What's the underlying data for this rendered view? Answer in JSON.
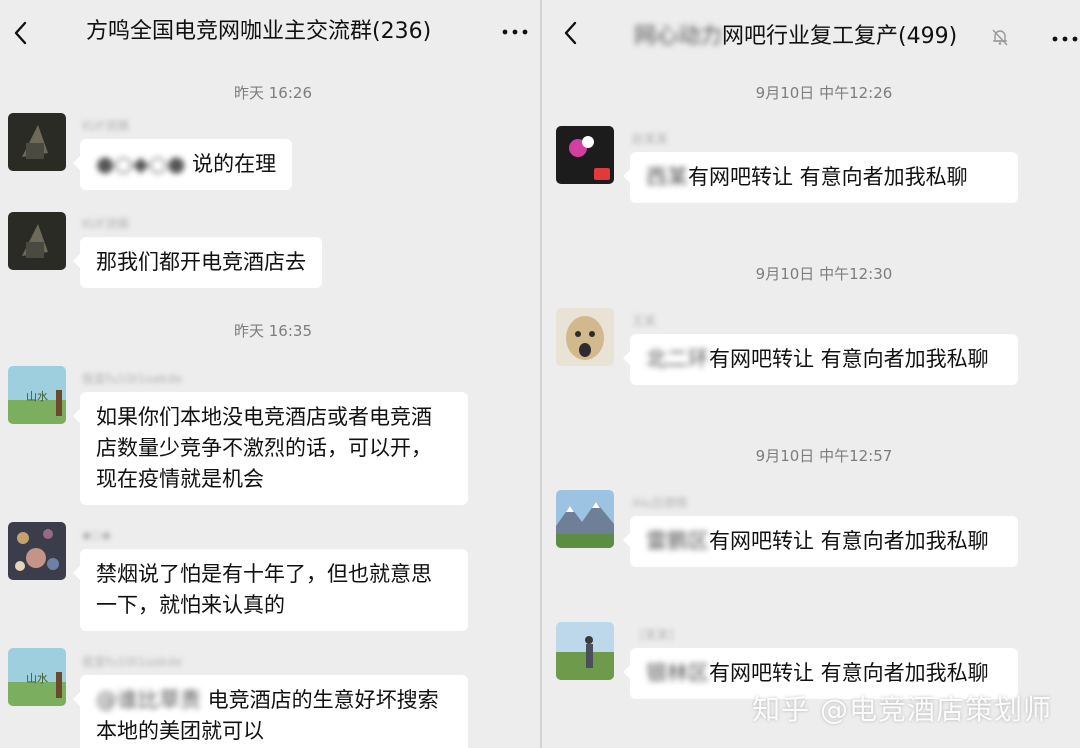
{
  "left_chat": {
    "title": "方鸣全国电竞网咖业主交流群(236)",
    "messages": [
      {
        "time": "昨天 16:26"
      },
      {
        "nick": "KUF测赛",
        "mention": "●○◆○● ",
        "text": "说的在理"
      },
      {
        "nick": "KUF测赛",
        "text": "那我们都开电竞酒店去"
      },
      {
        "time": "昨天 16:35"
      },
      {
        "nick": "我爱fu10t1oakde",
        "text": "如果你们本地没电竞酒店或者电竞酒店数量少竞争不激烈的话，可以开，现在疫情就是机会"
      },
      {
        "nick": "◆○◆",
        "text": "禁烟说了怕是有十年了，但也就意思一下，就怕来认真的"
      },
      {
        "nick": "我爱fu10t1oakde",
        "mention": "@谁比草责",
        "text": " 电竞酒店的生意好坏搜索本地的美团就可以"
      }
    ]
  },
  "right_chat": {
    "title_blur": "网心动力",
    "title": "网吧行业复工复产(499)",
    "messages": [
      {
        "time": "9月10日 中午12:26"
      },
      {
        "nick": "赵某某",
        "prefix": "西某",
        "text": "有网吧转让  有意向者加我私聊"
      },
      {
        "time": "9月10日 中午12:30"
      },
      {
        "nick": "王某",
        "prefix": "北二环",
        "text": "有网吧转让  有意向者加我私聊"
      },
      {
        "time": "9月10日 中午12:57"
      },
      {
        "nick": "Alu吕德晴",
        "prefix": "雷鹏区",
        "text": "有网吧转让  有意向者加我私聊"
      },
      {
        "nick": "[某某]",
        "prefix": "银林区",
        "text": "有网吧转让  有意向者加我私聊"
      }
    ]
  },
  "watermark": "知乎 @电竞酒店策划师",
  "colors": {
    "background": "#ededed",
    "bubble": "#ffffff",
    "timestamp": "#7d7d7d"
  },
  "icons": [
    "back-icon",
    "more-icon",
    "mute-bell-icon"
  ]
}
